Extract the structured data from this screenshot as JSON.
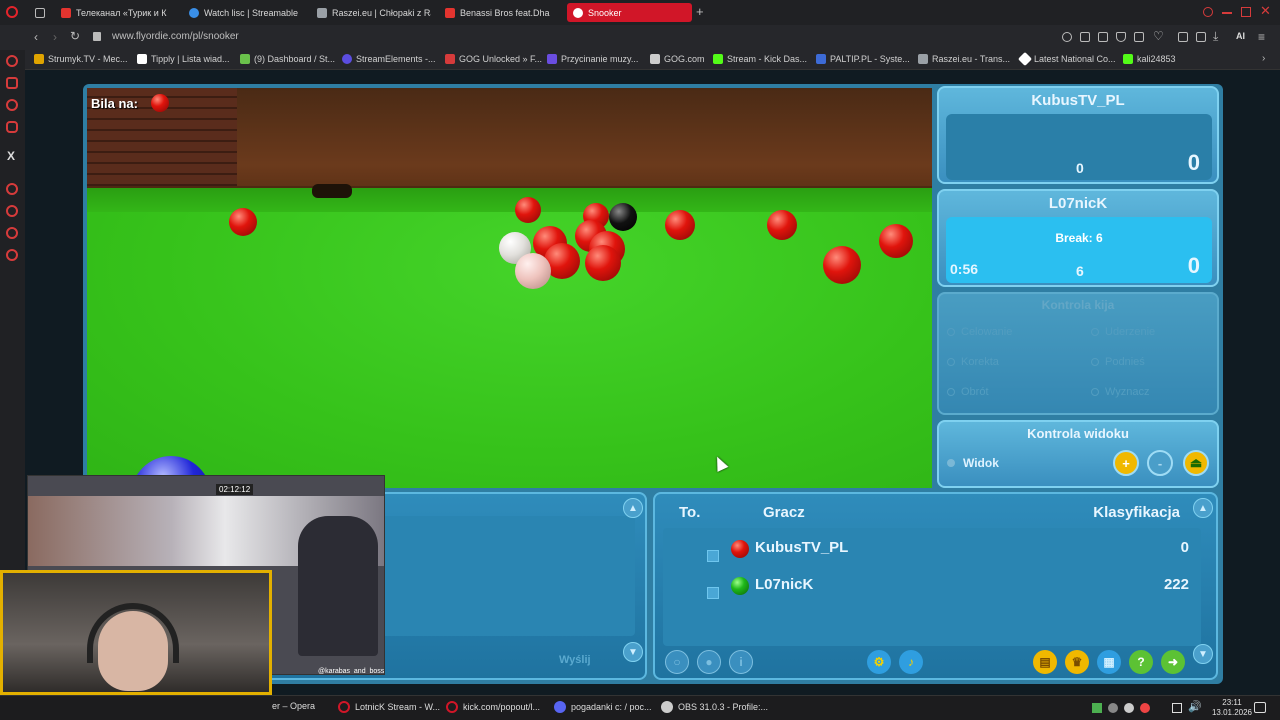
{
  "browser": {
    "tabs": [
      {
        "label": "Телеканал «Турик и К",
        "color": "#e3342f"
      },
      {
        "label": "Watch lisc | Streamable",
        "color": "#3a8fe8"
      },
      {
        "label": "Raszei.eu | Chłopaki z Ra",
        "color": "#9aa0a6"
      },
      {
        "label": "Benassi Bros feat.Dha",
        "color": "#e3342f"
      },
      {
        "label": "Snooker",
        "color": "#ffffff"
      }
    ],
    "new_tab": "+",
    "url": "www.flyordie.com/pl/snooker",
    "bookmarks": [
      {
        "label": "Strumyk.TV - Mec...",
        "color": "#e0a400"
      },
      {
        "label": "Tipply | Lista wiad...",
        "color": "#ffffff"
      },
      {
        "label": "(9) Dashboard / St...",
        "color": "#6ac14b"
      },
      {
        "label": "StreamElements -...",
        "color": "#5b4de0"
      },
      {
        "label": "GOG Unlocked » F...",
        "color": "#d63b3b"
      },
      {
        "label": "Przycinanie muzy...",
        "color": "#6a4de0"
      },
      {
        "label": "GOG.com",
        "color": "#cccccc"
      },
      {
        "label": "Stream - Kick Das...",
        "color": "#53fc18"
      },
      {
        "label": "PALTIP.PL - Syste...",
        "color": "#3d6bd6"
      },
      {
        "label": "Raszei.eu - Trans...",
        "color": "#9aa0a6"
      },
      {
        "label": "Latest National Co...",
        "color": "#ffffff"
      },
      {
        "label": "kali24853",
        "color": "#53fc18"
      }
    ]
  },
  "game": {
    "cue_ball_on": "Bila na:",
    "player1": {
      "name": "KubusTV_PL",
      "score": "0",
      "frames": "0"
    },
    "player2": {
      "name": "L07nicK",
      "break_label": "Break: 6",
      "timer": "0:56",
      "score": "6",
      "frames": "0"
    },
    "cue_control": {
      "title": "Kontrola kija",
      "options": [
        "Celowanie",
        "Uderzenie",
        "Korekta",
        "Podnieś",
        "Obrót",
        "Wyznacz"
      ]
    },
    "view_control": {
      "title": "Kontrola widoku",
      "option": "Widok"
    },
    "chat": {
      "send_label": "Wyślij"
    },
    "players_table": {
      "headers": {
        "turn": "To.",
        "player": "Gracz",
        "rank": "Klasyfikacja"
      },
      "rows": [
        {
          "name": "KubusTV_PL",
          "rank": "0",
          "ball_color": "#d81510"
        },
        {
          "name": "L07nicK",
          "rank": "222",
          "ball_color": "#1fb81a"
        }
      ]
    }
  },
  "webcam": {
    "timer": "02:12:12",
    "handle": "@karabas_and_boss"
  },
  "taskbar": {
    "items": [
      {
        "label": "er – Opera",
        "color": "#d11628"
      },
      {
        "label": "LotnicK Stream - W...",
        "color": "#d11628"
      },
      {
        "label": "kick.com/popout/l...",
        "color": "#d11628"
      },
      {
        "label": "pogadanki c: / poc...",
        "color": "#5865f2"
      },
      {
        "label": "OBS 31.0.3 - Profile:...",
        "color": "#cccccc"
      }
    ],
    "time": "23:11",
    "date": "13.01.2026"
  }
}
